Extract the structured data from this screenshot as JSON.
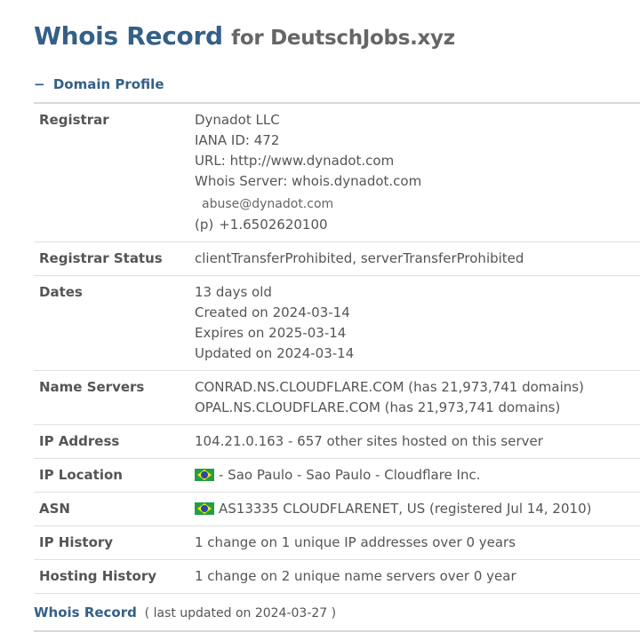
{
  "header": {
    "title": "Whois Record",
    "subtitle": "for DeutschJobs.xyz"
  },
  "section": {
    "toggle_icon": "minus-icon",
    "title": "Domain Profile"
  },
  "registrar": {
    "label": "Registrar",
    "name": "Dynadot LLC",
    "iana": "IANA ID: 472",
    "url": "URL: http://www.dynadot.com",
    "whois_server": "Whois Server: whois.dynadot.com",
    "email": "abuse@dynadot.com",
    "phone_prefix": "(p)",
    "phone": "+1.6502620100"
  },
  "registrar_status": {
    "label": "Registrar Status",
    "value": "clientTransferProhibited, serverTransferProhibited"
  },
  "dates": {
    "label": "Dates",
    "age": "13 days old",
    "created": "Created on 2024-03-14",
    "expires": "Expires on 2025-03-14",
    "updated": "Updated on 2024-03-14"
  },
  "name_servers": {
    "label": "Name Servers",
    "ns1": "CONRAD.NS.CLOUDFLARE.COM (has 21,973,741 domains)",
    "ns2": "OPAL.NS.CLOUDFLARE.COM (has 21,973,741 domains)"
  },
  "ip_address": {
    "label": "IP Address",
    "value": "104.21.0.163 - 657 other sites hosted on this server"
  },
  "ip_location": {
    "label": "IP Location",
    "flag_icon": "brazil-flag-icon",
    "value": "- Sao Paulo - Sao Paulo - Cloudflare Inc."
  },
  "asn": {
    "label": "ASN",
    "flag_icon": "brazil-flag-icon",
    "value": "AS13335 CLOUDFLARENET, US (registered Jul 14, 2010)"
  },
  "ip_history": {
    "label": "IP History",
    "value": "1 change on 1 unique IP addresses over 0 years"
  },
  "hosting_history": {
    "label": "Hosting History",
    "value": "1 change on 2 unique name servers over 0 year"
  },
  "whois_record": {
    "title": "Whois Record",
    "updated": "( last updated on 2024-03-27 )"
  },
  "colors": {
    "accent": "#346088",
    "text": "#555555",
    "rule": "#d9d9d9"
  }
}
